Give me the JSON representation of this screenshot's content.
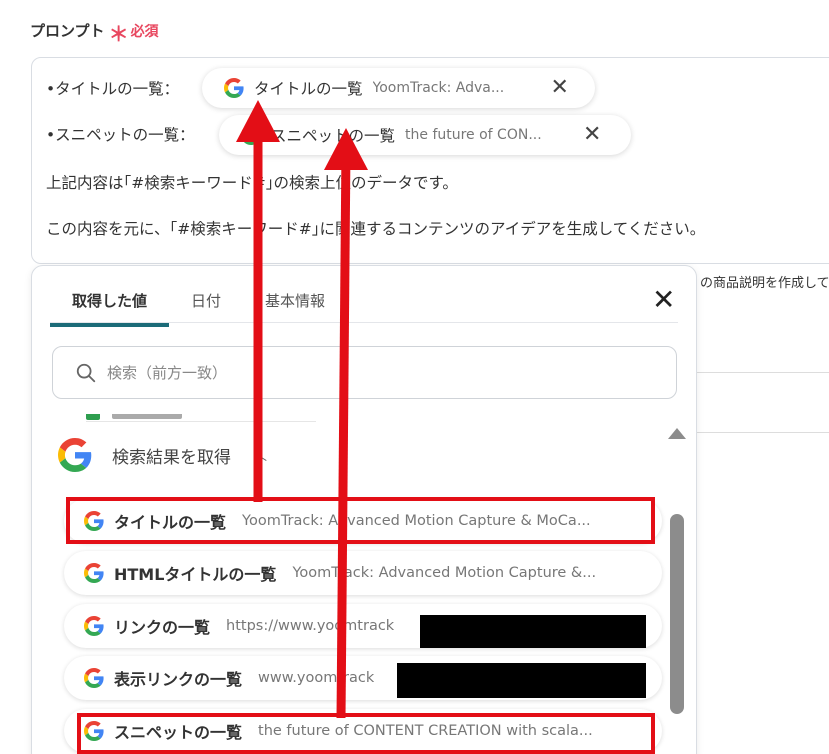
{
  "field": {
    "label": "プロンプト",
    "required_mark": "＊",
    "required_text": "必須"
  },
  "prompt": {
    "line1_label": "•タイトルの一覧：",
    "line2_label": "•スニペットの一覧：",
    "line3": "上記内容は｢#検索キーワード#｣の検索上位のデータです。",
    "line4": "この内容を元に、｢#検索キーワード#｣に関連するコンテンツのアイデアを生成してください。",
    "chip1": {
      "label": "タイトルの一覧",
      "value": "YoomTrack: Adva..."
    },
    "chip2": {
      "label": "スニペットの一覧",
      "value": "the future of CON..."
    },
    "chip_close": "✕"
  },
  "behind": {
    "hint_text": "の商品説明を作成して"
  },
  "panel": {
    "tabs": [
      {
        "label": "取得した値"
      },
      {
        "label": "日付"
      },
      {
        "label": "基本情報"
      }
    ],
    "close": "✕",
    "search_placeholder": "検索（前方一致）",
    "group_title": "検索結果を取得",
    "group_caret": "︿",
    "items": [
      {
        "label": "タイトルの一覧",
        "value": "YoomTrack: Advanced Motion Capture & MoCa..."
      },
      {
        "label": "HTMLタイトルの一覧",
        "value": "YoomTrack: Advanced Motion Capture &..."
      },
      {
        "label": "リンクの一覧",
        "value": "https://www.yoomtrack"
      },
      {
        "label": "表示リンクの一覧",
        "value": "www.yoomtrack"
      },
      {
        "label": "スニペットの一覧",
        "value": "the future of CONTENT CREATION with scala..."
      }
    ]
  },
  "colors": {
    "highlight": "#e30e16",
    "required": "#e8475f",
    "tab_underline": "#1b6b78"
  }
}
